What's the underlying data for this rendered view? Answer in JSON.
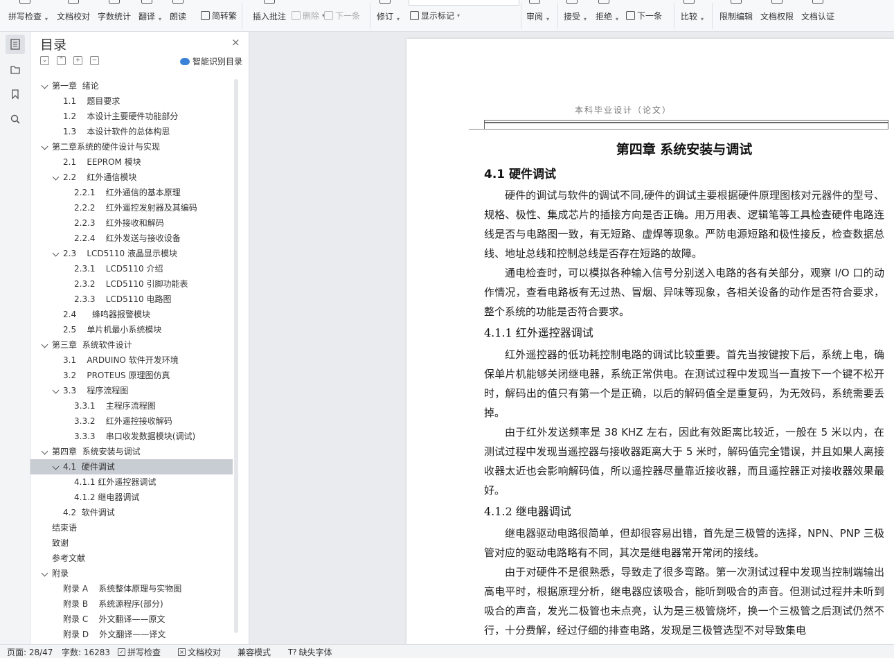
{
  "ribbon": {
    "spell_check": "拼写检查",
    "doc_proof": "文档校对",
    "word_count": "字数统计",
    "translate": "翻译",
    "read_aloud": "朗读",
    "simp_trad": "简转繁",
    "insert_comment": "插入批注",
    "delete": "删除",
    "next": "下一条",
    "track_changes": "修订",
    "show_markup": "显示标记",
    "review": "审阅",
    "accept": "接受",
    "reject": "拒绝",
    "next_change": "下一条",
    "compare": "比较",
    "restrict_edit": "限制编辑",
    "doc_permission": "文档权限",
    "doc_certify": "文档认证"
  },
  "toc": {
    "title": "目录",
    "smart_label": "智能识别目录",
    "close": "×",
    "items": [
      {
        "level": 1,
        "label": "第一章  绪论",
        "arrow": true
      },
      {
        "level": 2,
        "label": "1.1    题目要求"
      },
      {
        "level": 2,
        "label": "1.2    本设计主要硬件功能部分"
      },
      {
        "level": 2,
        "label": "1.3    本设计软件的总体构思"
      },
      {
        "level": 1,
        "label": "第二章系统的硬件设计与实现",
        "arrow": true
      },
      {
        "level": 2,
        "label": "2.1    EEPROM 模块"
      },
      {
        "level": 2,
        "label": "2.2    红外通信模块",
        "arrow": true
      },
      {
        "level": 3,
        "label": "2.2.1    红外通信的基本原理"
      },
      {
        "level": 3,
        "label": "2.2.2    红外遥控发射器及其编码"
      },
      {
        "level": 3,
        "label": "2.2.3    红外接收和解码"
      },
      {
        "level": 3,
        "label": "2.2.4    红外发送与接收设备"
      },
      {
        "level": 2,
        "label": "2.3    LCD5110 液晶显示模块",
        "arrow": true
      },
      {
        "level": 3,
        "label": "2.3.1    LCD5110 介绍"
      },
      {
        "level": 3,
        "label": "2.3.2    LCD5110 引脚功能表"
      },
      {
        "level": 3,
        "label": "2.3.3    LCD5110 电路图"
      },
      {
        "level": 2,
        "label": "2.4      蜂鸣器报警模块"
      },
      {
        "level": 2,
        "label": "2.5    单片机最小系统模块"
      },
      {
        "level": 1,
        "label": "第三章  系统软件设计",
        "arrow": true
      },
      {
        "level": 2,
        "label": "3.1    ARDUINO 软件开发环境"
      },
      {
        "level": 2,
        "label": "3.2    PROTEUS 原理图仿真"
      },
      {
        "level": 2,
        "label": "3.3    程序流程图",
        "arrow": true
      },
      {
        "level": 3,
        "label": "3.3.1    主程序流程图"
      },
      {
        "level": 3,
        "label": "3.3.2    红外遥控接收解码"
      },
      {
        "level": 3,
        "label": "3.3.3    串口收发数据模块(调试)"
      },
      {
        "level": 1,
        "label": "第四章  系统安装与调试",
        "arrow": true
      },
      {
        "level": 2,
        "label": "4.1  硬件调试",
        "arrow": true,
        "selected": true
      },
      {
        "level": 3,
        "label": "4.1.1 红外遥控器调试"
      },
      {
        "level": 3,
        "label": "4.1.2 继电器调试"
      },
      {
        "level": 2,
        "label": "4.2  软件调试"
      },
      {
        "level": 1,
        "label": "结束语"
      },
      {
        "level": 1,
        "label": "致谢"
      },
      {
        "level": 1,
        "label": "参考文献"
      },
      {
        "level": 1,
        "label": "附录",
        "arrow": true
      },
      {
        "level": 2,
        "label": "附录 A    系统整体原理与实物图"
      },
      {
        "level": 2,
        "label": "附录 B    系统源程序(部分)"
      },
      {
        "level": 2,
        "label": "附录 C    外文翻译——原文"
      },
      {
        "level": 2,
        "label": "附录 D    外文翻译——译文"
      }
    ]
  },
  "document": {
    "header": "本科毕业设计（论文）",
    "chapter_title": "第四章  系统安装与调试",
    "s41": "4.1 硬件调试",
    "p1": "硬件的调试与软件的调试不同,硬件的调试主要根据硬件原理图核对元器件的型号、规格、极性、集成芯片的插接方向是否正确。用万用表、逻辑笔等工具检查硬件电路连线是否与电路图一致，有无短路、虚焊等现象。严防电源短路和极性接反，检查数据总线、地址总线和控制总线是否存在短路的故障。",
    "p2": "通电检查时，可以模拟各种输入信号分别送入电路的各有关部分，观察 I/O 口的动作情况，查看电路板有无过热、冒烟、异味等现象，各相关设备的动作是否符合要求，整个系统的功能是否符合要求。",
    "s411": "4.1.1 红外遥控器调试",
    "p3": "红外遥控器的低功耗控制电路的调试比较重要。首先当按键按下后，系统上电，确保单片机能够关闭继电器，系统正常供电。在测试过程中发现当一直按下一个键不松开时，解码出的值只有第一个是正确，以后的解码值全是重复码，为无效码，系统需要丢掉。",
    "p4": "由于红外发送频率是 38 KHZ 左右，因此有效距离比较近，一般在 5 米以内，在测试过程中发现当遥控器与接收器距离大于 5 米时，解码值完全错误，并且如果人离接收器太近也会影响解码值，所以遥控器尽量靠近接收器，而且遥控器正对接收器效果最好。",
    "s412": "4.1.2 继电器调试",
    "p5": "继电器驱动电路很简单，但却很容易出错，首先是三极管的选择，NPN、PNP 三极管对应的驱动电路略有不同，其次是继电器常开常闭的接线。",
    "p6": "由于对硬件不是很熟悉，导致走了很多弯路。第一次测试过程中发现当控制端输出高电平时，根据原理分析，继电器应该吸合，能听到吸合的声音。但测试过程并未听到吸合的声音，发光二极管也未点亮，认为是三极管烧坏，换一个三极管之后测试仍然不行，十分费解，经过仔细的排查电路，发现是三极管选型不对导致集电"
  },
  "status": {
    "page": "页面: 28/47",
    "words": "字数: 16283",
    "spell": "拼写检查",
    "proof": "文档校对",
    "compat": "兼容模式",
    "missing_font": "缺失字体"
  }
}
